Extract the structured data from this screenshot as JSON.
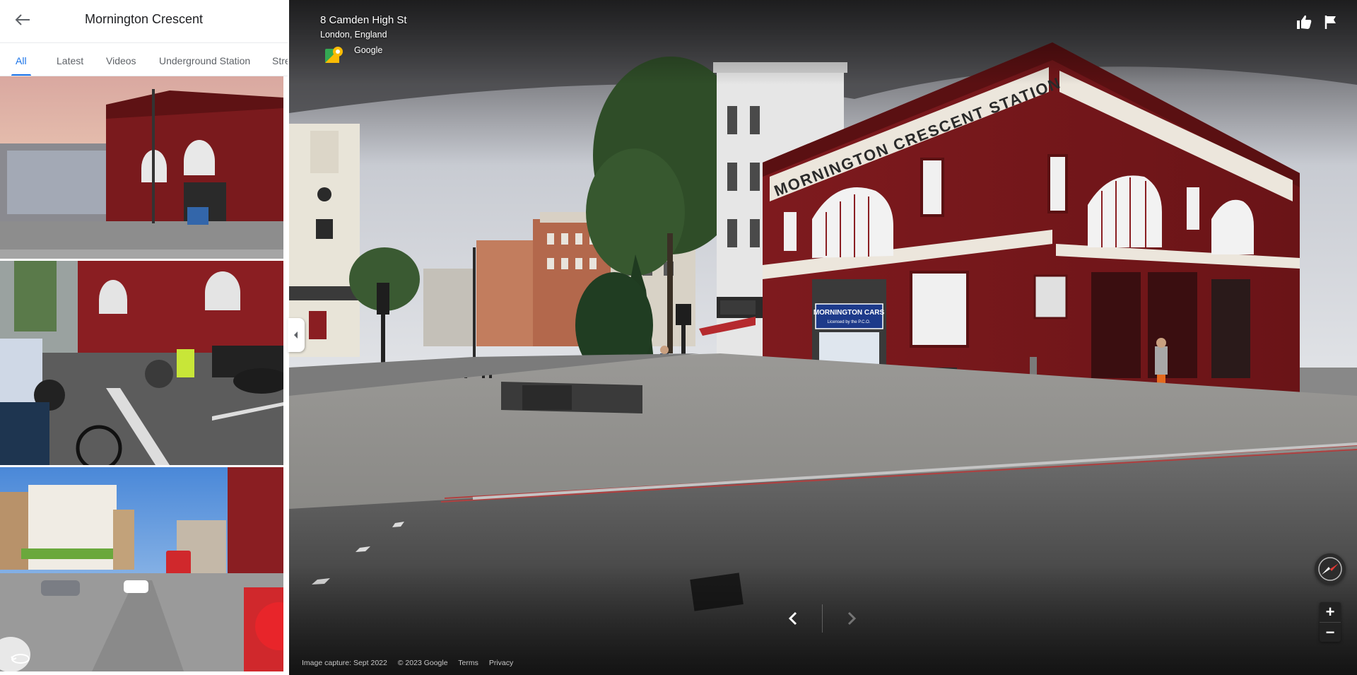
{
  "panel": {
    "title": "Mornington Crescent",
    "tabs": [
      {
        "label": "All",
        "active": true
      },
      {
        "label": "Latest",
        "active": false
      },
      {
        "label": "Videos",
        "active": false
      },
      {
        "label": "Underground Station",
        "active": false
      },
      {
        "label": "Stre",
        "active": false
      }
    ],
    "accent_color": "#1a73e8"
  },
  "location": {
    "title": "8 Camden High St",
    "subtitle": "London, England",
    "brand": "Google"
  },
  "scene": {
    "station_sign": "MORNINGTON CRESCENT STATION",
    "shop_sign": "MORNINGTON CARS",
    "shop_subsign": "Licensed by the P.C.O.",
    "station_color": "#7a1a1d"
  },
  "controls": {
    "zoom_in": "+",
    "zoom_out": "−",
    "icons": [
      "back-arrow-icon",
      "thumb-up-icon",
      "flag-icon",
      "chevron-left-icon",
      "chevron-right-icon",
      "compass-icon",
      "rotate-360-icon",
      "maps-pin-icon"
    ]
  },
  "footer": {
    "capture": "Image capture: Sept 2022",
    "copyright": "© 2023 Google",
    "terms": "Terms",
    "privacy": "Privacy"
  }
}
